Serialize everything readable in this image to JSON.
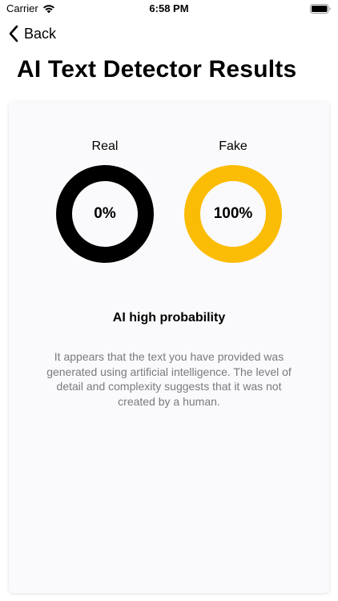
{
  "status_bar": {
    "carrier": "Carrier",
    "time": "6:58 PM"
  },
  "nav": {
    "back_label": "Back"
  },
  "page": {
    "title": "AI Text Detector Results"
  },
  "results": {
    "real": {
      "label": "Real",
      "value_text": "0%",
      "percent": 0,
      "color": "#000000"
    },
    "fake": {
      "label": "Fake",
      "value_text": "100%",
      "percent": 100,
      "color": "#FBBC05"
    },
    "verdict": "AI high probability",
    "description": "It appears that the text you have provided was generated using artificial intelligence. The level of detail and complexity suggests that it was not created by a human."
  },
  "icons": {
    "wifi": "wifi-icon",
    "battery": "battery-icon",
    "back": "chevron-left-icon"
  }
}
